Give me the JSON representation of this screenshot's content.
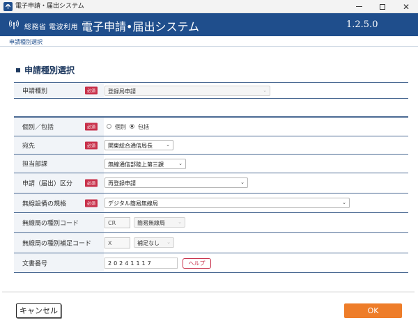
{
  "window": {
    "title": "電子申請・届出システム"
  },
  "header": {
    "ministry": "総務省 電波利用",
    "system_title": "電子申請•届出システム",
    "version": "1.2.5.0"
  },
  "breadcrumb": "申請種別選択",
  "section_title": "申請種別選択",
  "required_badge": "必須",
  "fields": {
    "app_type": {
      "label": "申請種別",
      "value": "登録局申請"
    },
    "individual": {
      "label": "個別／包括",
      "options": [
        "個別",
        "包括"
      ],
      "selected": "包括"
    },
    "destination": {
      "label": "宛先",
      "value": "関東総合通信局長"
    },
    "department": {
      "label": "担当部課",
      "value": "無線通信部陸上第三課"
    },
    "category": {
      "label": "申請（届出）区分",
      "value": "再登録申請"
    },
    "standard": {
      "label": "無線設備の規格",
      "value": "デジタル簡易無線局"
    },
    "station_code": {
      "label": "無線局の種別コード",
      "code": "CR",
      "name": "簡易無線局"
    },
    "supp_code": {
      "label": "無線局の種別補足コード",
      "code": "X",
      "name": "補足なし"
    },
    "doc_number": {
      "label": "文書番号",
      "value": "20241117",
      "help_label": "ヘルプ"
    }
  },
  "footer": {
    "cancel_label": "キャンセル",
    "ok_label": "OK"
  },
  "colors": {
    "header_blue": "#1f4e8c",
    "required_red": "#c8314b",
    "ok_orange": "#ee7d29"
  }
}
